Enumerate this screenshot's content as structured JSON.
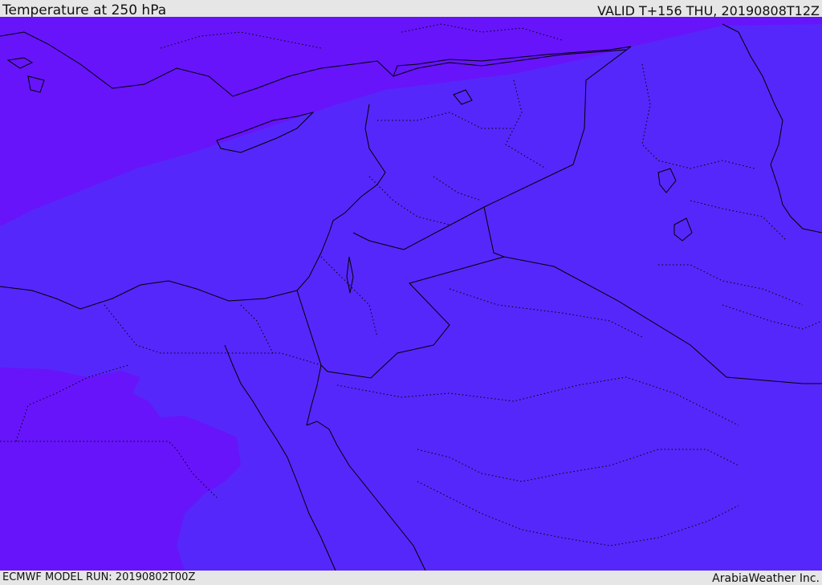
{
  "header": {
    "title": "Temperature at 250 hPa",
    "valid": "VALID T+156 THU, 20190808T12Z"
  },
  "footer": {
    "model_run": "ECMWF MODEL RUN: 20190802T00Z",
    "credit": "ArabiaWeather Inc."
  },
  "colors": {
    "cold_band": "#6714fb",
    "main_band": "#5627fa",
    "coast": "#000000",
    "frame": "#e6e6e6"
  }
}
